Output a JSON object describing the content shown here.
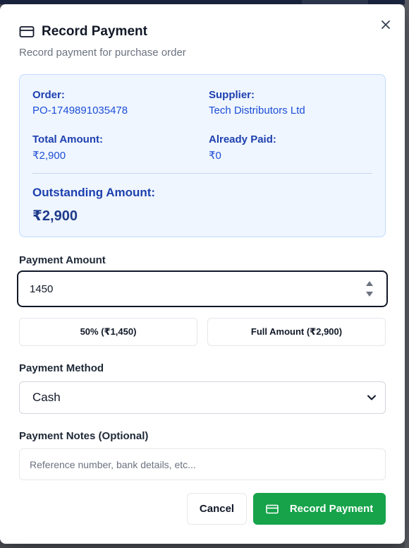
{
  "dialog": {
    "title": "Record Payment",
    "subtitle": "Record payment for purchase order",
    "title_icon": "credit-card-icon",
    "close_icon": "close-icon"
  },
  "summary": {
    "order_label": "Order:",
    "order_value": "PO-1749891035478",
    "supplier_label": "Supplier:",
    "supplier_value": "Tech Distributors Ltd",
    "total_label": "Total Amount:",
    "total_value": "₹2,900",
    "paid_label": "Already Paid:",
    "paid_value": "₹0",
    "outstanding_label": "Outstanding Amount:",
    "outstanding_value": "₹2,900"
  },
  "payment_amount": {
    "label": "Payment Amount",
    "value": "1450"
  },
  "quick_amounts": {
    "half_label": "50% (₹1,450)",
    "full_label": "Full Amount (₹2,900)"
  },
  "payment_method": {
    "label": "Payment Method",
    "selected": "Cash"
  },
  "notes": {
    "label": "Payment Notes (Optional)",
    "placeholder": "Reference number, bank details, etc..."
  },
  "actions": {
    "cancel_label": "Cancel",
    "record_label": "Record Payment",
    "record_icon": "credit-card-icon"
  },
  "colors": {
    "primary_green": "#16a34a",
    "summary_bg": "#eff6ff",
    "summary_text": "#1e40af"
  }
}
